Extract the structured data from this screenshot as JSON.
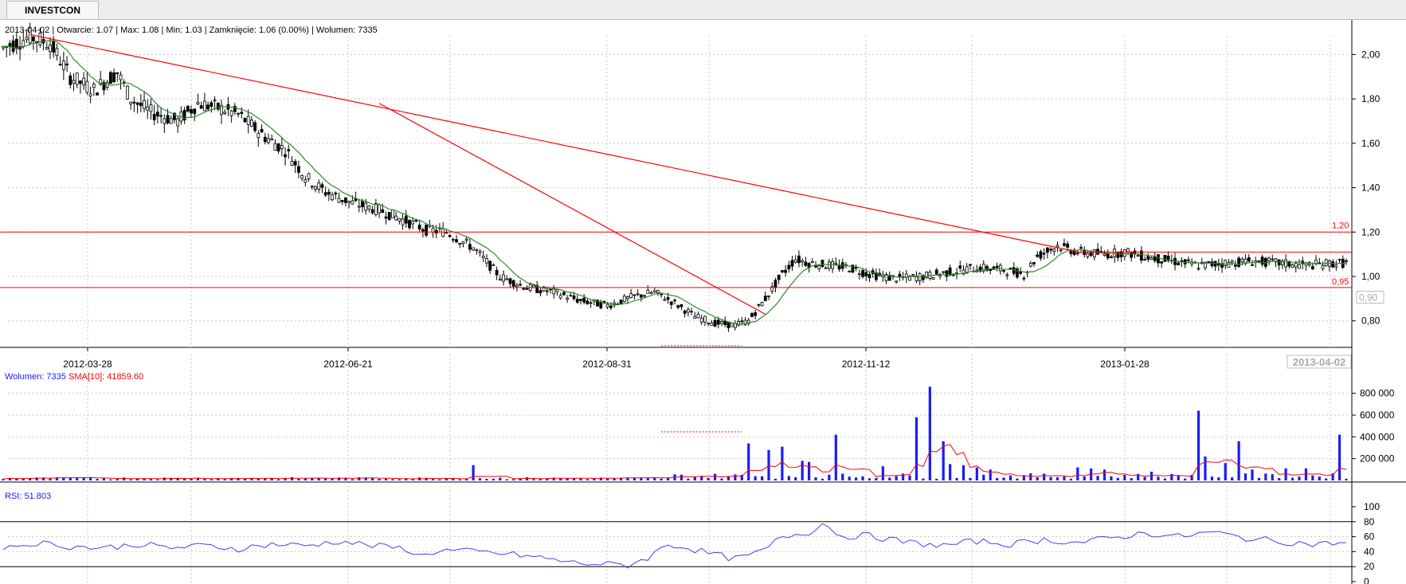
{
  "tab": {
    "label": "INVESTCON"
  },
  "info_line": "2013-04-02 | Otwarcie: 1.07 | Max: 1.08 | Min: 1.03 | Zamknięcie: 1.06 (0.00%)  | Wolumen: 7335",
  "colors": {
    "up": "#000000",
    "trend": "#ff0000",
    "sma": "#2e8b2e",
    "volume": "#1a1aff",
    "rsi": "#4040ff",
    "grid": "#c8c8c8"
  },
  "chart_data": {
    "type": "candlestick",
    "price_axis": {
      "ticks": [
        "2,00",
        "1,80",
        "1,60",
        "1,40",
        "1,20",
        "1,00",
        "0,80"
      ],
      "ylim": [
        0.72,
        2.12
      ]
    },
    "x_ticks": [
      "2012-03-28",
      "2012-06-21",
      "2012-08-31",
      "2012-11-12",
      "2013-01-28"
    ],
    "last_date_label": "2013-04-02",
    "levels": [
      {
        "value": 1.2,
        "label": "1,20"
      },
      {
        "value": 0.95,
        "label": "0,95"
      },
      {
        "value": 1.11,
        "label": ""
      }
    ],
    "current_price_label": "0,90",
    "price_points": [
      [
        0,
        2.03
      ],
      [
        8,
        2.08
      ],
      [
        14,
        2.05
      ],
      [
        20,
        1.9
      ],
      [
        27,
        1.84
      ],
      [
        34,
        1.92
      ],
      [
        38,
        1.8
      ],
      [
        44,
        1.74
      ],
      [
        52,
        1.7
      ],
      [
        58,
        1.78
      ],
      [
        64,
        1.76
      ],
      [
        70,
        1.73
      ],
      [
        78,
        1.63
      ],
      [
        84,
        1.57
      ],
      [
        90,
        1.45
      ],
      [
        96,
        1.38
      ],
      [
        104,
        1.33
      ],
      [
        112,
        1.3
      ],
      [
        120,
        1.25
      ],
      [
        126,
        1.21
      ],
      [
        132,
        1.2
      ],
      [
        140,
        1.13
      ],
      [
        148,
        1.0
      ],
      [
        156,
        0.95
      ],
      [
        164,
        0.93
      ],
      [
        172,
        0.89
      ],
      [
        180,
        0.87
      ],
      [
        188,
        0.91
      ],
      [
        194,
        0.93
      ],
      [
        200,
        0.88
      ],
      [
        206,
        0.82
      ],
      [
        212,
        0.79
      ],
      [
        218,
        0.78
      ],
      [
        222,
        0.8
      ],
      [
        228,
        0.92
      ],
      [
        232,
        1.01
      ],
      [
        236,
        1.08
      ],
      [
        240,
        1.06
      ],
      [
        246,
        1.05
      ],
      [
        252,
        1.04
      ],
      [
        258,
        1.01
      ],
      [
        266,
        0.99
      ],
      [
        274,
        1.0
      ],
      [
        282,
        1.02
      ],
      [
        290,
        1.04
      ],
      [
        298,
        1.03
      ],
      [
        304,
        1.01
      ],
      [
        308,
        1.09
      ],
      [
        314,
        1.14
      ],
      [
        320,
        1.11
      ],
      [
        328,
        1.1
      ],
      [
        334,
        1.11
      ],
      [
        340,
        1.09
      ],
      [
        348,
        1.07
      ],
      [
        356,
        1.05
      ],
      [
        364,
        1.06
      ],
      [
        372,
        1.07
      ],
      [
        380,
        1.06
      ],
      [
        388,
        1.05
      ],
      [
        396,
        1.06
      ]
    ],
    "volume": {
      "label": "Wolumen: 7335",
      "sma_label": "SMA[10]: 41859.60",
      "axis_ticks": [
        "800 000",
        "600 000",
        "400 000",
        "200 000"
      ],
      "ylim": [
        0,
        900000
      ],
      "spikes": [
        [
          140,
          140000
        ],
        [
          175,
          60000
        ],
        [
          203,
          160000
        ],
        [
          215,
          170000
        ],
        [
          222,
          340000
        ],
        [
          225,
          340000
        ],
        [
          228,
          280000
        ],
        [
          232,
          310000
        ],
        [
          238,
          180000
        ],
        [
          240,
          170000
        ],
        [
          248,
          420000
        ],
        [
          255,
          300000
        ],
        [
          262,
          130000
        ],
        [
          272,
          580000
        ],
        [
          276,
          860000
        ],
        [
          280,
          360000
        ],
        [
          282,
          150000
        ],
        [
          286,
          140000
        ],
        [
          290,
          120000
        ],
        [
          294,
          100000
        ],
        [
          320,
          120000
        ],
        [
          324,
          110000
        ],
        [
          328,
          100000
        ],
        [
          342,
          80000
        ],
        [
          356,
          640000
        ],
        [
          358,
          220000
        ],
        [
          361,
          340000
        ],
        [
          364,
          160000
        ],
        [
          368,
          360000
        ],
        [
          372,
          100000
        ],
        [
          382,
          110000
        ],
        [
          388,
          110000
        ],
        [
          398,
          420000
        ],
        [
          410,
          190000
        ],
        [
          418,
          130000
        ],
        [
          428,
          80000
        ]
      ]
    },
    "rsi": {
      "label": "RSI: 51.803",
      "axis_ticks": [
        "100",
        "80",
        "60",
        "40",
        "20",
        "0"
      ],
      "ylim": [
        0,
        100
      ],
      "points": [
        [
          0,
          45
        ],
        [
          10,
          52
        ],
        [
          20,
          47
        ],
        [
          30,
          45
        ],
        [
          40,
          50
        ],
        [
          50,
          45
        ],
        [
          60,
          48
        ],
        [
          70,
          44
        ],
        [
          80,
          50
        ],
        [
          90,
          48
        ],
        [
          100,
          54
        ],
        [
          110,
          48
        ],
        [
          120,
          44
        ],
        [
          124,
          34
        ],
        [
          130,
          42
        ],
        [
          140,
          40
        ],
        [
          150,
          37
        ],
        [
          160,
          32
        ],
        [
          170,
          25
        ],
        [
          180,
          23
        ],
        [
          186,
          22
        ],
        [
          192,
          32
        ],
        [
          198,
          50
        ],
        [
          204,
          45
        ],
        [
          210,
          38
        ],
        [
          218,
          30
        ],
        [
          226,
          40
        ],
        [
          232,
          60
        ],
        [
          240,
          66
        ],
        [
          244,
          78
        ],
        [
          250,
          60
        ],
        [
          256,
          62
        ],
        [
          262,
          58
        ],
        [
          270,
          52
        ],
        [
          280,
          48
        ],
        [
          290,
          54
        ],
        [
          300,
          50
        ],
        [
          310,
          56
        ],
        [
          320,
          52
        ],
        [
          330,
          58
        ],
        [
          340,
          65
        ],
        [
          350,
          60
        ],
        [
          360,
          66
        ],
        [
          370,
          58
        ],
        [
          380,
          54
        ],
        [
          390,
          50
        ],
        [
          400,
          52
        ]
      ]
    }
  }
}
